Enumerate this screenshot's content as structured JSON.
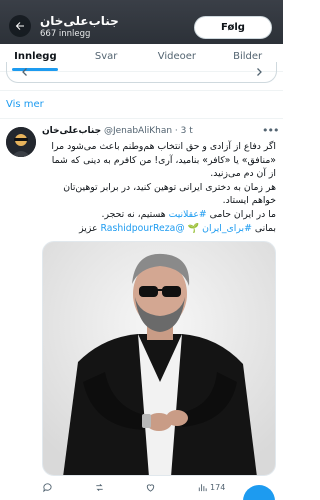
{
  "header": {
    "name": "جناب‌علی‌خان",
    "post_count": "667 innlegg",
    "follow_label": "Følg"
  },
  "tabs": [
    {
      "label": "Innlegg",
      "active": true
    },
    {
      "label": "Svar",
      "active": false
    },
    {
      "label": "Videoer",
      "active": false
    },
    {
      "label": "Bilder",
      "active": false
    }
  ],
  "show_more": "Vis mer",
  "tweet": {
    "display_name": "جناب‌علی‌خان",
    "handle": "@JenabAliKhan",
    "dot": "·",
    "time": "3 t",
    "lines": [
      "اگر دفاع از آزادی و حق انتخاب هم‌وطنم باعث می‌شود مرا «منافق» یا «کافر» بنامید، آری! من کافرم به دینی که شما از آن دم می‌زنید.",
      "هر زمان به دختری ایرانی توهین کنید، در برابر توهین‌تان خواهم ایستاد."
    ],
    "line3_prefix": "ما در ایران حامی ",
    "line3_link": "#عقلانیت",
    "line3_suffix": " هستیم، نه تحجر.",
    "line4_prefix": "بمانی ",
    "line4_link": "#برای_ایران",
    "line4_mention": "@RashidpourReza",
    "line4_suffix": " عزیز",
    "plant_emoji": "🌱",
    "views": "174",
    "brand_color": "#1d9bf0"
  }
}
